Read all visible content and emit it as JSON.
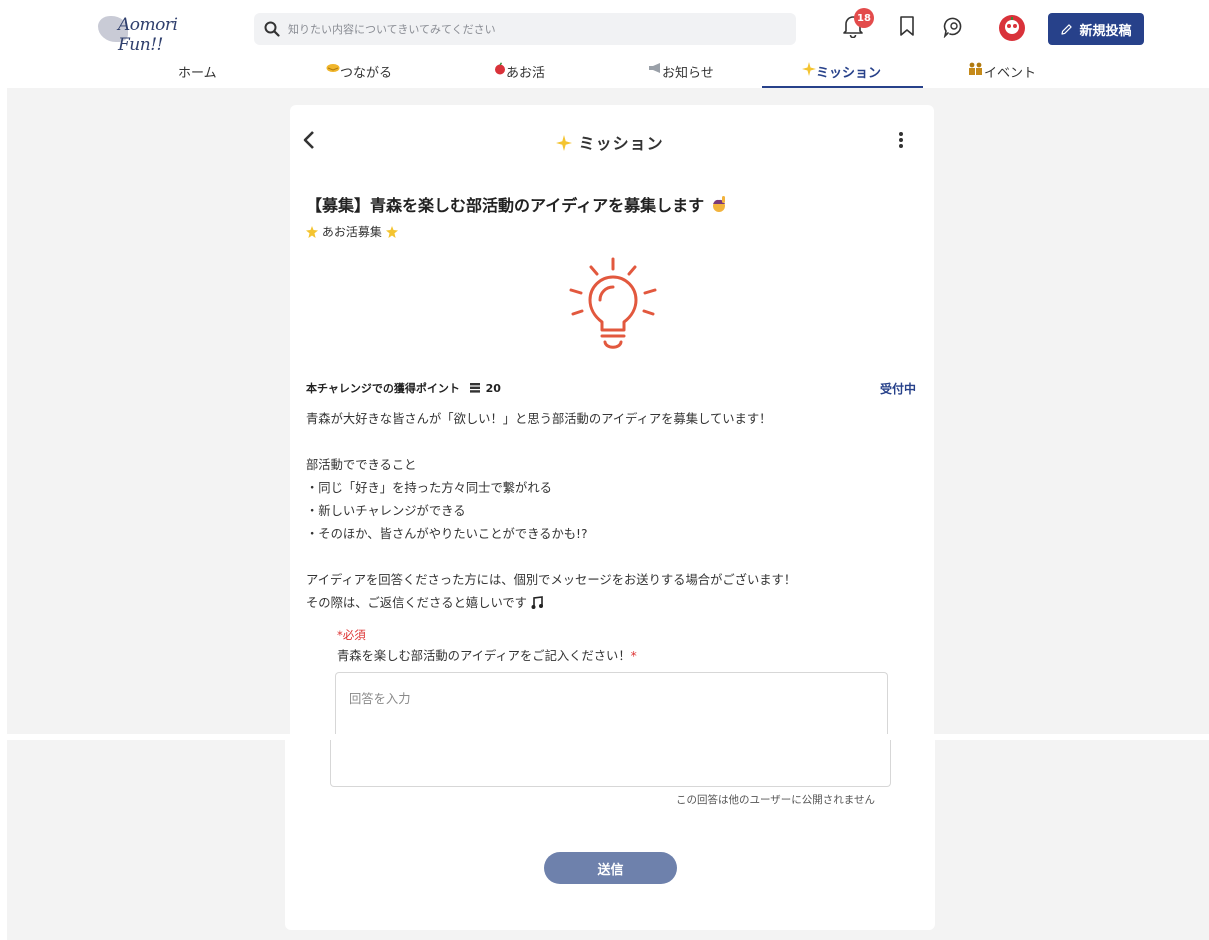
{
  "header": {
    "logo_text": "Aomori Fun!!",
    "search_placeholder": "知りたい内容についてきいてみてください",
    "notification_count": "18",
    "post_button_label": "新規投稿"
  },
  "nav": {
    "items": [
      {
        "label": "ホーム",
        "icon": ""
      },
      {
        "label": "つながる",
        "icon": "handshake-icon"
      },
      {
        "label": "あお活",
        "icon": "apple-icon"
      },
      {
        "label": "お知らせ",
        "icon": "megaphone-icon"
      },
      {
        "label": "ミッション",
        "icon": "sparkle-icon"
      },
      {
        "label": "イベント",
        "icon": "people-icon"
      }
    ],
    "active": "ミッション"
  },
  "card": {
    "title": "ミッション",
    "post_title": "【募集】青森を楽しむ部活動のアイディアを募集します",
    "tag": "あお活募集",
    "points_label": "本チャレンジでの獲得ポイント",
    "points_value": "20",
    "status": "受付中",
    "description": [
      "青森が大好きな皆さんが「欲しい！」と思う部活動のアイディアを募集しています！",
      "",
      "部活動でできること",
      "・同じ「好き」を持った方々同士で繋がれる",
      "・新しいチャレンジができる",
      "・そのほか、皆さんがやりたいことができるかも!?",
      "",
      "アイディアを回答くださった方には、個別でメッセージをお送りする場合がございます！",
      "その際は、ご返信くださると嬉しいです"
    ],
    "required_label": "*必須",
    "question": "青森を楽しむ部活動のアイディアをご記入ください！",
    "question_mark": "*",
    "answer_placeholder": "回答を入力",
    "privacy_note": "この回答は他のユーザーに公開されません",
    "submit_label": "送信"
  },
  "colors": {
    "brand": "#27418a",
    "badge": "#e34b4b",
    "bulb": "#e2583e",
    "submit": "#6e81ac",
    "required": "#dd3333"
  }
}
